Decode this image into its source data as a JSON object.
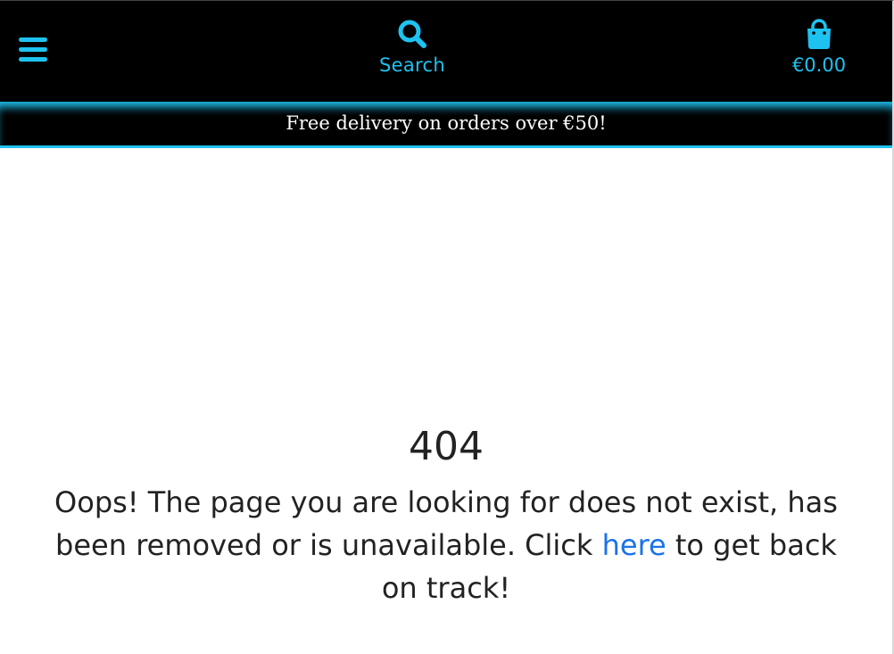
{
  "header": {
    "menu_icon": "hamburger-menu-icon",
    "search": {
      "icon": "search-icon",
      "label": "Search"
    },
    "bag": {
      "icon": "shopping-bag-icon",
      "total": "€0.00"
    },
    "accent_color": "#1ec2f0",
    "background_color": "#000000"
  },
  "banner": {
    "text": "Free delivery on orders over €50!"
  },
  "error": {
    "code": "404",
    "message_before": "Oops! The page you are looking for does not exist, has been removed or is unavailable. Click ",
    "link_text": "here",
    "message_after": " to get back on track!",
    "link_color": "#1a73e8"
  }
}
